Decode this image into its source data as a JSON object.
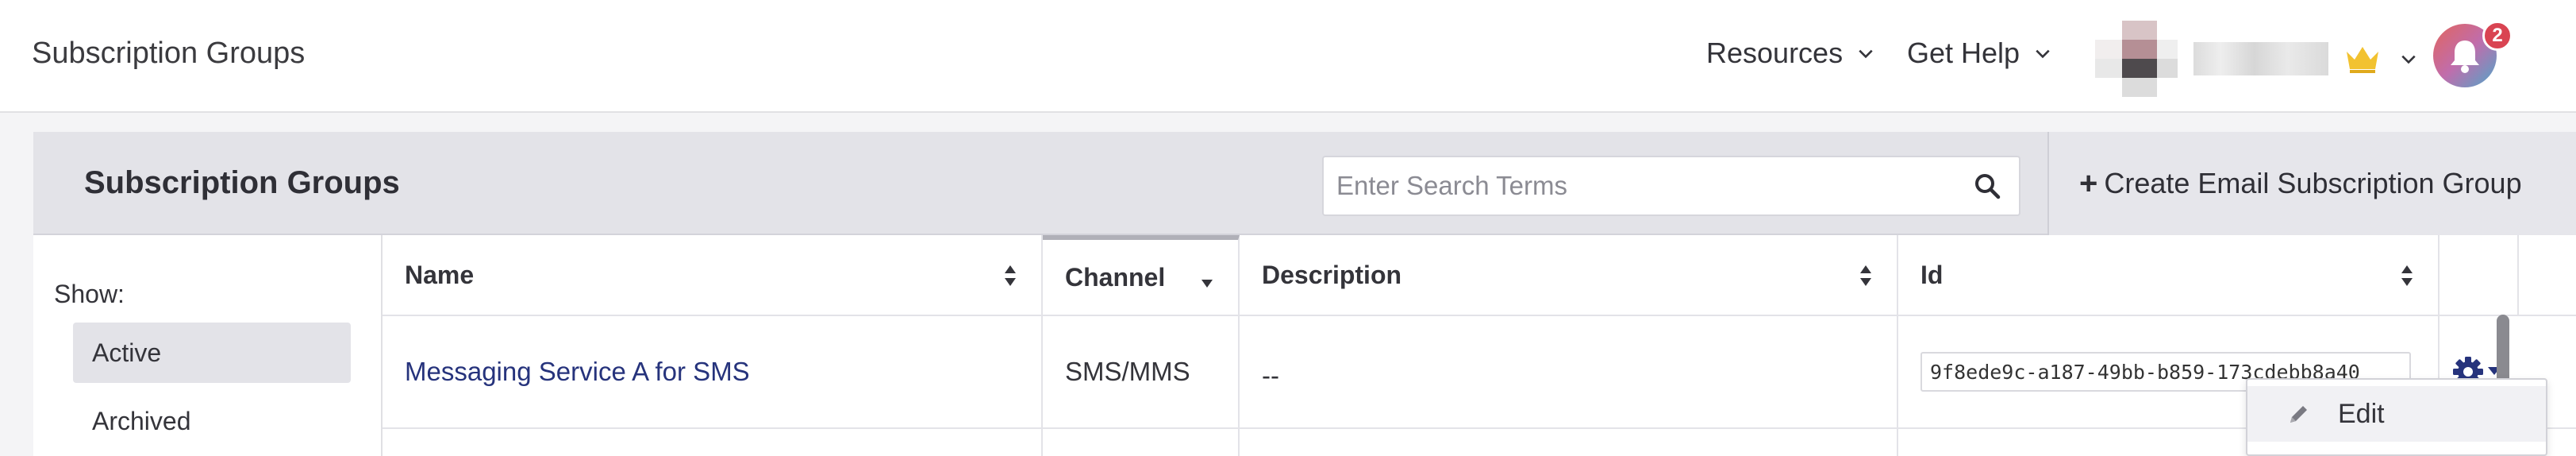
{
  "app": {
    "title": "Subscription Groups"
  },
  "nav": {
    "resources_label": "Resources",
    "help_label": "Get Help",
    "notification_count": "2"
  },
  "panel": {
    "title": "Subscription Groups",
    "search_placeholder": "Enter Search Terms",
    "create_label": "Create Email Subscription Group"
  },
  "sidebar": {
    "show_label": "Show:",
    "filters": [
      {
        "label": "Active",
        "selected": true
      },
      {
        "label": "Archived",
        "selected": false
      }
    ]
  },
  "table": {
    "columns": [
      "Name",
      "Channel",
      "Description",
      "Id"
    ],
    "rows": [
      {
        "name": "Messaging Service A for SMS",
        "channel": "SMS/MMS",
        "description": "--",
        "id": "9f8ede9c-a187-49bb-b859-173cdebb8a40"
      }
    ]
  },
  "row_menu": {
    "items": [
      {
        "label": "Edit",
        "icon": "pencil-icon"
      }
    ]
  },
  "colors": {
    "link": "#26337c",
    "header_bg": "#e3e3e8",
    "badge": "#d94452",
    "crown": "#f2c230"
  }
}
